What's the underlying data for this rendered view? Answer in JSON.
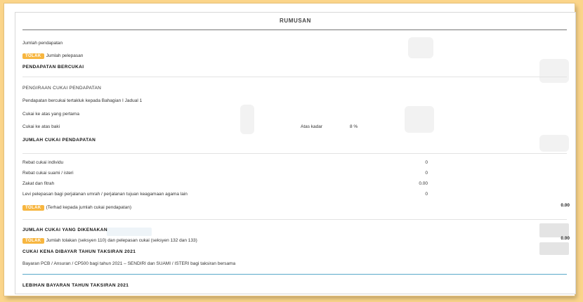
{
  "title": "RUMUSAN",
  "lines": {
    "jumlah_pendapatan": "Jumlah pendapatan",
    "tolak_badge": "TOLAK",
    "jumlah_pelepasan": "Jumlah pelepasan",
    "pendapatan_bercukai": "PENDAPATAN BERCUKAI",
    "pengiraan": "PENGIRAAN CUKAI PENDAPATAN",
    "pendapatan_tertakluk": "Pendapatan bercukai tertakluk kepada Bahagian I Jadual 1",
    "cukai_pertama": "Cukai ke atas yang pertama",
    "cukai_baki": "Cukai ke atas baki",
    "atas_kadar": "Atas kadar",
    "kadar_value": "8 %",
    "jumlah_cukai": "JUMLAH CUKAI PENDAPATAN",
    "rebat_individu": "Rebat cukai individu",
    "rebat_individu_val": "0",
    "rebat_suami": "Rebat cukai suami / isteri",
    "rebat_suami_val": "0",
    "zakat": "Zakat dan fitrah",
    "zakat_val": "0.00",
    "levi": "Levi pelepasan bagi perjalanan umrah / perjalanan tujuan keagamaan agama lain",
    "levi_val": "0",
    "terhad": "(Terhad kepada jumlah cukai pendapatan)",
    "terhad_total": "0.00",
    "cukai_dikenakan": "JUMLAH CUKAI YANG DIKENAKAN",
    "jumlah_tolakan": "Jumlah tolakan (seksyen 110) dan pelepasan cukai (seksyen 132 dan 133)",
    "tolakan_total": "0.00",
    "cukai_kena_dibayar": "CUKAI KENA DIBAYAR TAHUN TAKSIRAN 2021",
    "bayaran_pcb": "Bayaran PCB / Ansuran / CP500 bagi tahun 2021 – SENDIRI dan SUAMI / ISTERI bagi taksiran bersama",
    "lebihan": "LEBIHAN BAYARAN TAHUN TAKSIRAN 2021"
  }
}
